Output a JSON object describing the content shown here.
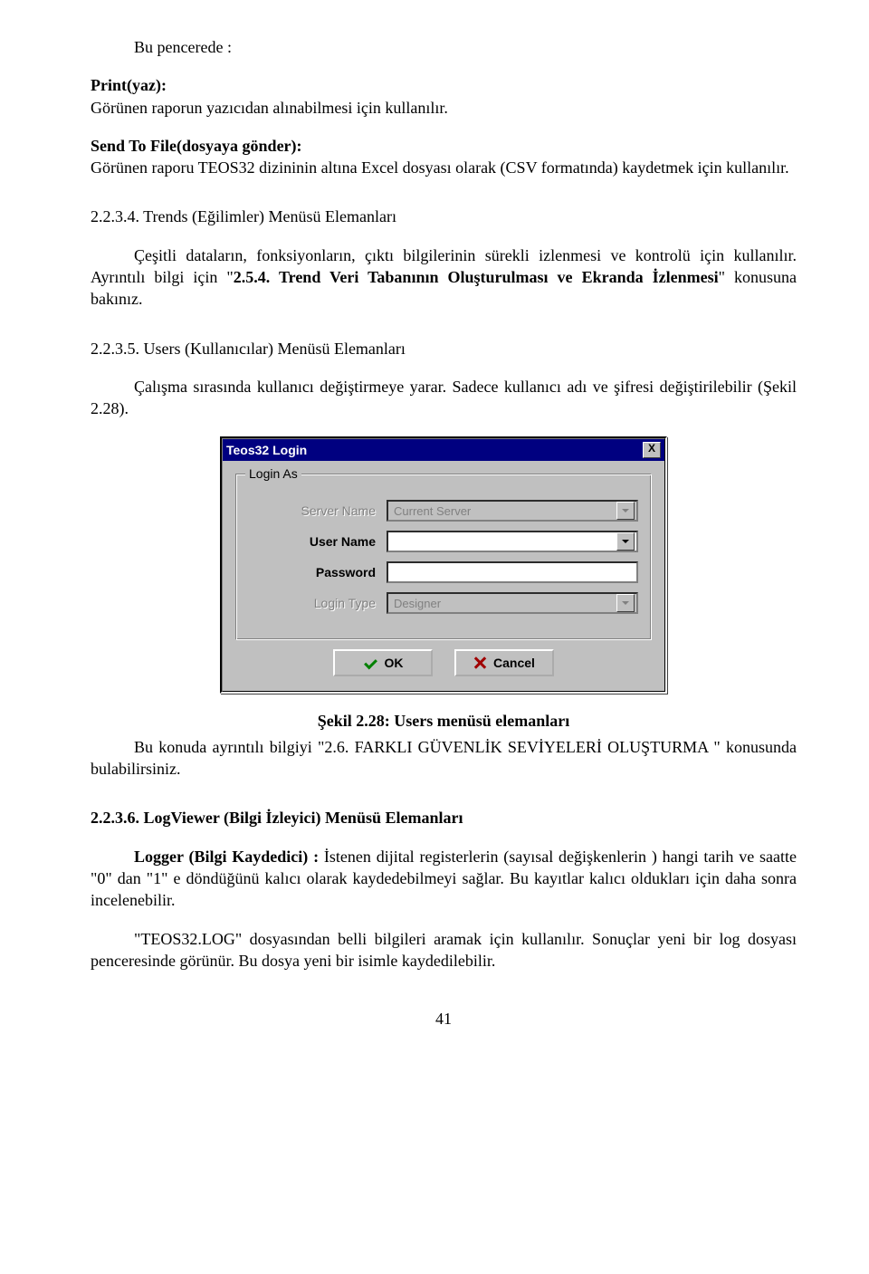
{
  "p_intro_indent": "Bu pencerede :",
  "p_print_title": "Print(yaz):",
  "p_print_body": "Görünen raporun yazıcıdan alınabilmesi için kullanılır.",
  "p_send_title": "Send To File(dosyaya gönder):",
  "p_send_body": "Görünen raporu TEOS32 dizininin altına Excel dosyası olarak (CSV formatında) kaydetmek için kullanılır.",
  "h_trends": "2.2.3.4. Trends (Eğilimler) Menüsü Elemanları",
  "p_trends_pre": "Çeşitli dataların, fonksiyonların, çıktı bilgilerinin sürekli izlenmesi  ve kontrolü için kullanılır. Ayrıntılı bilgi için \"",
  "p_trends_ref": "2.5.4. Trend Veri Tabanının Oluşturulması ve Ekranda İzlenmesi",
  "p_trends_post": "\" konusuna bakınız.",
  "h_users": "2.2.3.5. Users (Kullanıcılar) Menüsü Elemanları",
  "p_users": "Çalışma sırasında kullanıcı değiştirmeye yarar. Sadece kullanıcı adı ve şifresi değiştirilebilir (Şekil 2.28).",
  "dialog": {
    "title": "Teos32 Login",
    "close": "X",
    "group": "Login As",
    "server_label": "Server Name",
    "server_value": "Current Server",
    "user_label": "User Name",
    "user_value": "",
    "pass_label": "Password",
    "pass_value": "",
    "type_label": "Login Type",
    "type_value": "Designer",
    "ok": "OK",
    "cancel": "Cancel"
  },
  "caption": "Şekil 2.28: Users menüsü elemanları",
  "p_users_ref_pre": "Bu konuda ayrıntılı bilgiyi \"",
  "p_users_ref_mid": "2.6. FARKLI GÜVENLİK SEVİYELERİ OLUŞTURMA",
  "p_users_ref_post": " \" konusunda bulabilirsiniz.",
  "h_logviewer": "2.2.3.6. LogViewer (Bilgi İzleyici) Menüsü Elemanları",
  "p_logger_label": "Logger (Bilgi Kaydedici) :",
  "p_logger_body": "  İstenen dijital registerlerin (sayısal değişkenlerin ) hangi tarih ve saatte \"0\" dan \"1\" e döndüğünü kalıcı olarak kaydedebilmeyi sağlar. Bu kayıtlar kalıcı oldukları için daha sonra incelenebilir.",
  "p_teoslog": "\"TEOS32.LOG\" dosyasından belli bilgileri aramak için kullanılır. Sonuçlar yeni bir log dosyası penceresinde görünür. Bu dosya yeni bir isimle kaydedilebilir.",
  "page_number": "41"
}
